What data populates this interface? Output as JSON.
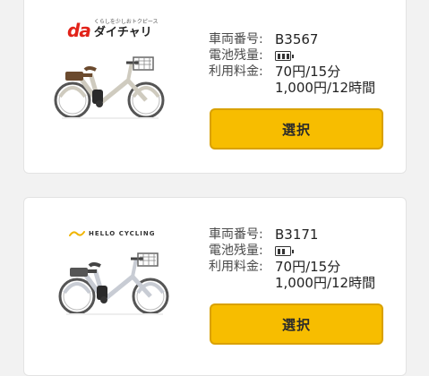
{
  "labels": {
    "vehicle_number": "車両番号:",
    "battery_level": "電池残量:",
    "usage_fee": "利用料金:"
  },
  "bikes": [
    {
      "provider_logo": {
        "tagline": "くらしを少しおトクピース",
        "mark": "da",
        "name": "ダイチャリ"
      },
      "vehicle_number": "B3567",
      "battery_level": "full",
      "battery_cells": 3,
      "fee_line1": "70円/15分",
      "fee_line2": "1,000円/12時間",
      "select_label": "選択",
      "bike_color": "#cfcbbf",
      "icon": "bicycle-icon"
    },
    {
      "provider_logo": {
        "name": "HELLO CYCLING"
      },
      "vehicle_number": "B3171",
      "battery_level": "medium",
      "battery_cells": 2,
      "fee_line1": "70円/15分",
      "fee_line2": "1,000円/12時間",
      "select_label": "選択",
      "bike_color": "#c8ccd4",
      "icon": "bicycle-icon"
    }
  ],
  "colors": {
    "button": "#f7bd00",
    "button_border": "#d9a100",
    "daichari_red": "#e2231a",
    "hello_yellow": "#f0b400"
  }
}
